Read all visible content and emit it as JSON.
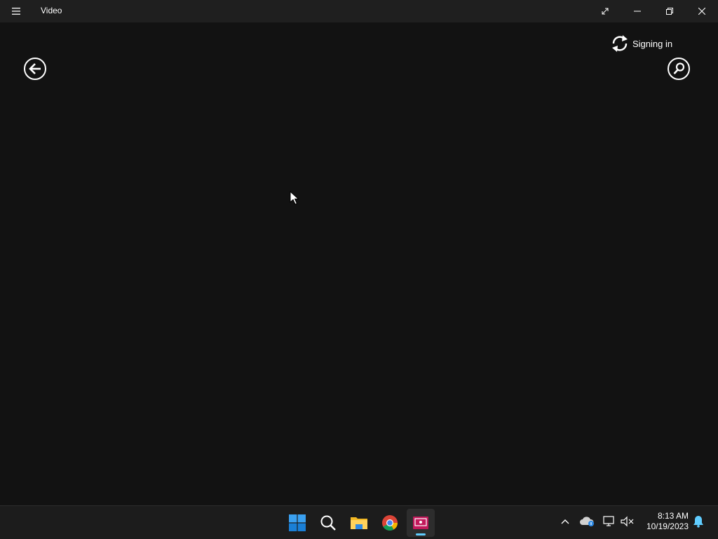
{
  "window": {
    "title": "Video",
    "background": "#121212"
  },
  "header": {
    "signin_label": "Signing in"
  },
  "taskbar": {
    "apps": [
      "start-icon",
      "search-icon",
      "file-explorer-icon",
      "chrome-icon",
      "video-app-icon"
    ],
    "active_app": "video-app-icon",
    "accent": "#60cdff"
  },
  "tray": {
    "time": "8:13 AM",
    "date": "10/19/2023"
  }
}
